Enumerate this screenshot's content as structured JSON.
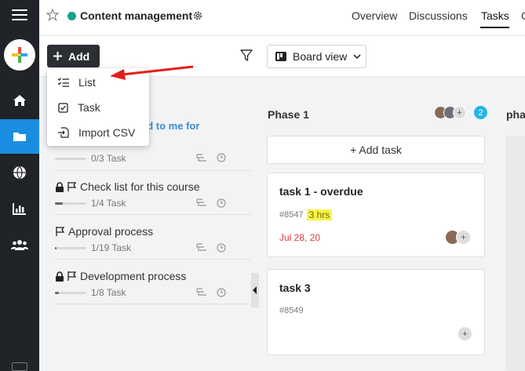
{
  "header": {
    "project_title": "Content management",
    "tabs": [
      "Overview",
      "Discussions",
      "Tasks",
      "C"
    ]
  },
  "toolbar": {
    "add_label": "Add",
    "view_label": "Board view"
  },
  "add_menu": {
    "items": [
      "List",
      "Task",
      "Import CSV"
    ]
  },
  "lists": {
    "assigned_text": "ed to me for",
    "rows": [
      {
        "title": "",
        "meta": "0/3 Task",
        "progress": 0.0
      },
      {
        "title": "Check list for this course",
        "meta": "1/4 Task",
        "progress": 0.25
      },
      {
        "title": "Approval process",
        "meta": "1/19 Task",
        "progress": 0.05
      },
      {
        "title": "Development process",
        "meta": "1/8 Task",
        "progress": 0.125
      }
    ]
  },
  "phase1": {
    "title": "Phase 1",
    "member_count": "2",
    "add_task_label": "+ Add task",
    "cards": [
      {
        "title": "task 1 - overdue",
        "id": "#8547",
        "estimate": "3 hrs",
        "due": "Jul 28, 20"
      },
      {
        "title": "task 3",
        "id": "#8549"
      }
    ]
  },
  "phase2": {
    "title": "pha"
  },
  "colors": {
    "rail": "#202327",
    "accent": "#1b8de0",
    "project_dot": "#18a38a",
    "overdue": "#e23b3b",
    "badge": "#23b6e5",
    "highlight": "#f8f24a",
    "annotation_arrow": "#e0201b"
  }
}
